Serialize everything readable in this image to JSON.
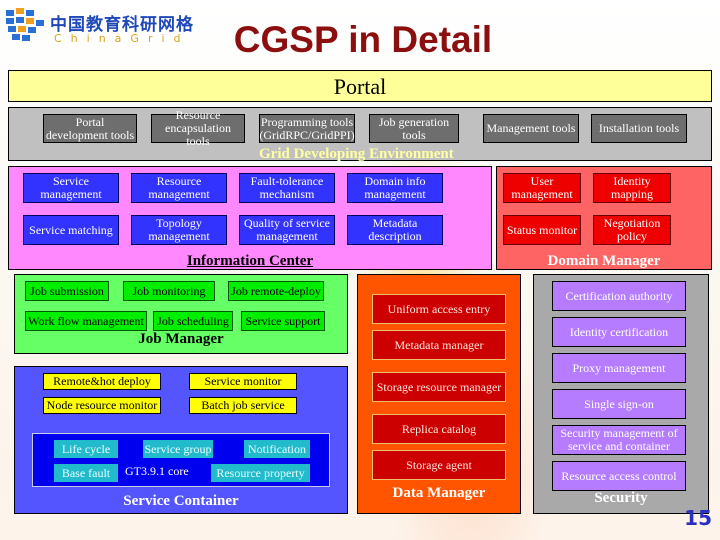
{
  "logo": {
    "cn": "中国教育科研网格",
    "en": "ChinaGrid"
  },
  "title": "CGSP in Detail",
  "page_number": "15",
  "portal": {
    "label": "Portal"
  },
  "grid_env": {
    "title": "Grid Developing Environment",
    "tools": [
      "Portal development tools",
      "Resource encapsulation tools",
      "Programming tools (GridRPC/GridPPI)",
      "Job generation tools",
      "Management tools",
      "Installation tools"
    ]
  },
  "info_center": {
    "title": "Information Center",
    "items": [
      "Service management",
      "Resource management",
      "Fault-tolerance mechanism",
      "Domain info management",
      "Service matching",
      "Topology management",
      "Quality of service management",
      "Metadata description"
    ]
  },
  "domain_manager": {
    "title": "Domain Manager",
    "items": [
      "User management",
      "Identity mapping",
      "Status monitor",
      "Negotiation policy"
    ]
  },
  "job_manager": {
    "title": "Job Manager",
    "items": [
      "Job submission",
      "Job monitoring",
      "Job remote-deploy",
      "Work flow management",
      "Job scheduling",
      "Service support"
    ]
  },
  "service_container": {
    "title": "Service Container",
    "services": [
      "Remote&hot deploy",
      "Service monitor",
      "Node resource monitor",
      "Batch job service"
    ],
    "core": {
      "label": "GT3.9.1 core",
      "items": [
        "Life cycle",
        "Service group",
        "Notification",
        "Base fault",
        "Resource property"
      ]
    }
  },
  "data_manager": {
    "title": "Data Manager",
    "items": [
      "Uniform access entry",
      "Metadata manager",
      "Storage resource manager",
      "Replica catalog",
      "Storage agent"
    ]
  },
  "security": {
    "title": "Security",
    "items": [
      "Certification authority",
      "Identity certification",
      "Proxy management",
      "Single sign-on",
      "Security management of service and container",
      "Resource access control"
    ]
  }
}
